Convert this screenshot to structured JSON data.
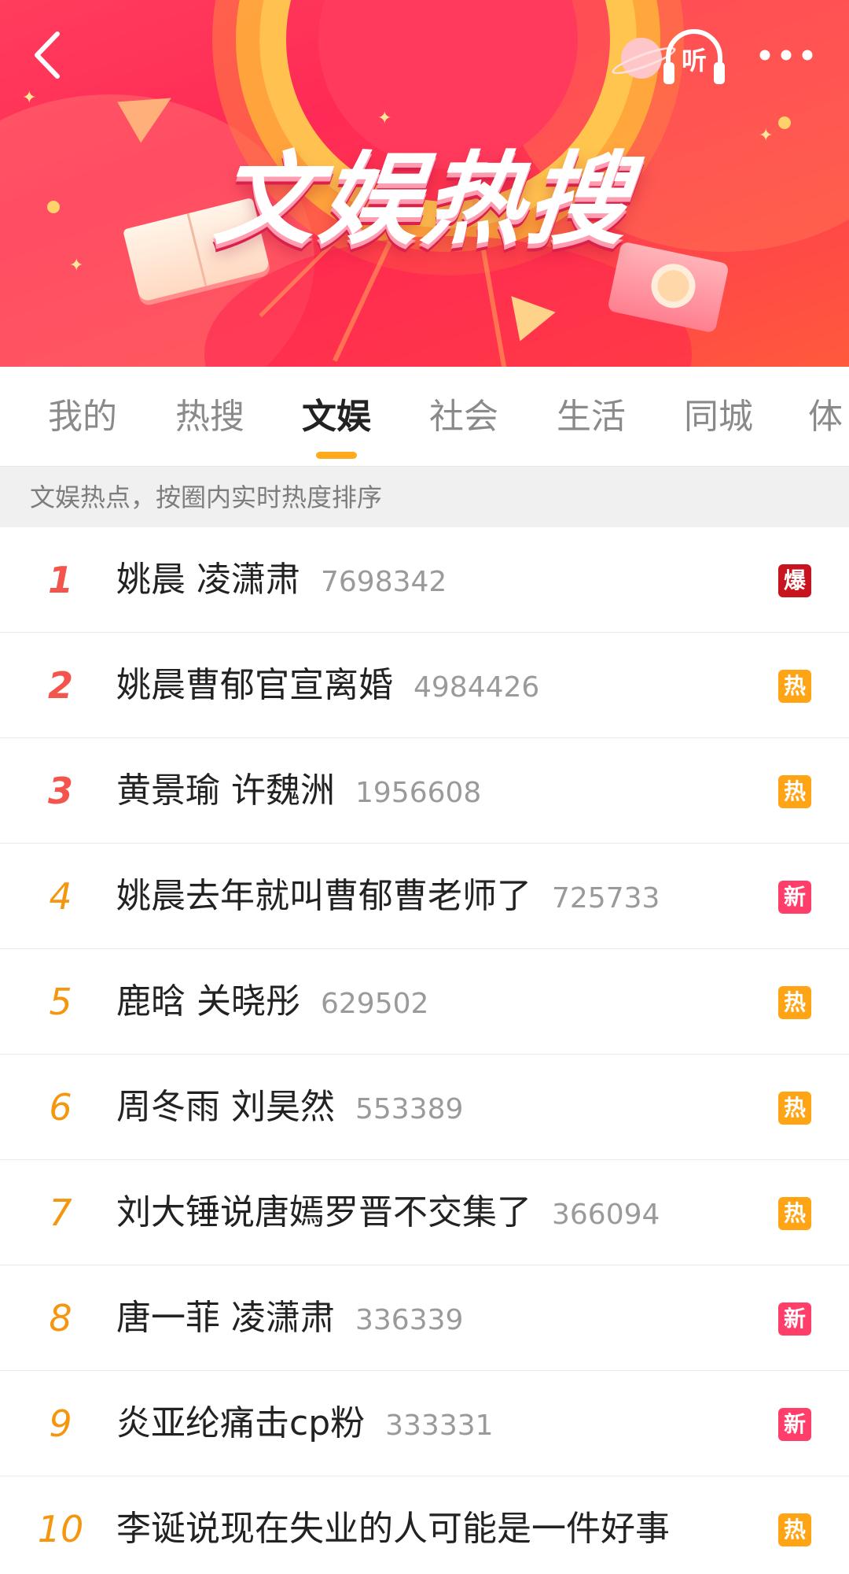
{
  "header": {
    "title": "文娱热搜",
    "listen_label": "听",
    "icons": {
      "back": "back-arrow-icon",
      "listen": "headphones-icon",
      "more": "more-dots-icon"
    }
  },
  "tabs": [
    {
      "label": "我的",
      "active": false
    },
    {
      "label": "热搜",
      "active": false
    },
    {
      "label": "文娱",
      "active": true
    },
    {
      "label": "社会",
      "active": false
    },
    {
      "label": "生活",
      "active": false
    },
    {
      "label": "同城",
      "active": false
    },
    {
      "label": "体",
      "active": false
    }
  ],
  "subtitle": "文娱热点，按圈内实时热度排序",
  "colors": {
    "accent_tab": "#ffab1c",
    "rank_top3": "#f3544b",
    "rank_rest": "#f5960f",
    "badge_bao": "#c8141e",
    "badge_re": "#ffa414",
    "badge_xin": "#ff3f6a"
  },
  "list": [
    {
      "rank": "1",
      "title": "姚晨 凌潇肃",
      "count": "7698342",
      "badge": "爆",
      "badge_type": "bao"
    },
    {
      "rank": "2",
      "title": "姚晨曹郁官宣离婚",
      "count": "4984426",
      "badge": "热",
      "badge_type": "re"
    },
    {
      "rank": "3",
      "title": "黄景瑜 许魏洲",
      "count": "1956608",
      "badge": "热",
      "badge_type": "re"
    },
    {
      "rank": "4",
      "title": "姚晨去年就叫曹郁曹老师了",
      "count": "725733",
      "badge": "新",
      "badge_type": "xin"
    },
    {
      "rank": "5",
      "title": "鹿晗 关晓彤",
      "count": "629502",
      "badge": "热",
      "badge_type": "re"
    },
    {
      "rank": "6",
      "title": "周冬雨 刘昊然",
      "count": "553389",
      "badge": "热",
      "badge_type": "re"
    },
    {
      "rank": "7",
      "title": "刘大锤说唐嫣罗晋不交集了",
      "count": "366094",
      "badge": "热",
      "badge_type": "re"
    },
    {
      "rank": "8",
      "title": "唐一菲 凌潇肃",
      "count": "336339",
      "badge": "新",
      "badge_type": "xin"
    },
    {
      "rank": "9",
      "title": "炎亚纶痛击cp粉",
      "count": "333331",
      "badge": "新",
      "badge_type": "xin"
    },
    {
      "rank": "10",
      "title": "李诞说现在失业的人可能是一件好事",
      "count": "",
      "badge": "热",
      "badge_type": "re"
    }
  ]
}
